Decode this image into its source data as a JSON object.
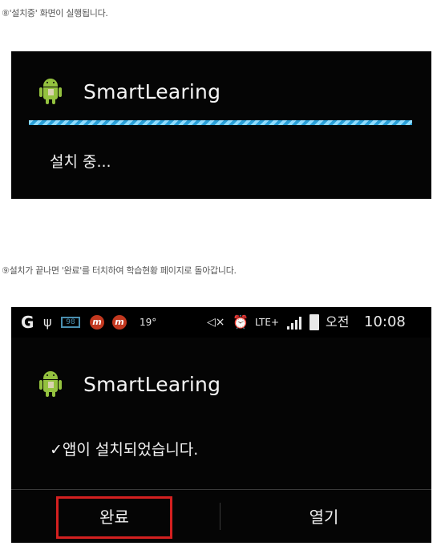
{
  "captions": {
    "step8_number": "⑧",
    "step8_text": "'설치중' 화면이 실행됩니다.",
    "step9_number": "⑨",
    "step9_text": "설치가 끝나면 '완료'를 터치하여 학습현황 페이지로 돌아갑니다."
  },
  "installing_screen": {
    "app_name": "SmartLearing",
    "app_icon": "android-icon",
    "status": "설치 중..."
  },
  "status_bar": {
    "left_icons": [
      "g-logo-icon",
      "usb-icon",
      "battery-98-icon",
      "notification-m-icon",
      "notification-m-icon"
    ],
    "battery_level": "98",
    "temperature": "19°",
    "right_icons": [
      "mute-icon",
      "alarm-icon",
      "lte-icon",
      "signal-icon",
      "charging-battery-icon"
    ],
    "network": "LTE+",
    "ampm": "오전",
    "time": "10:08"
  },
  "installed_screen": {
    "app_name": "SmartLearing",
    "app_icon": "android-icon",
    "message": "✓앱이 설치되었습니다.",
    "done_button": "완료",
    "open_button": "열기",
    "highlight_color": "#d42020"
  }
}
